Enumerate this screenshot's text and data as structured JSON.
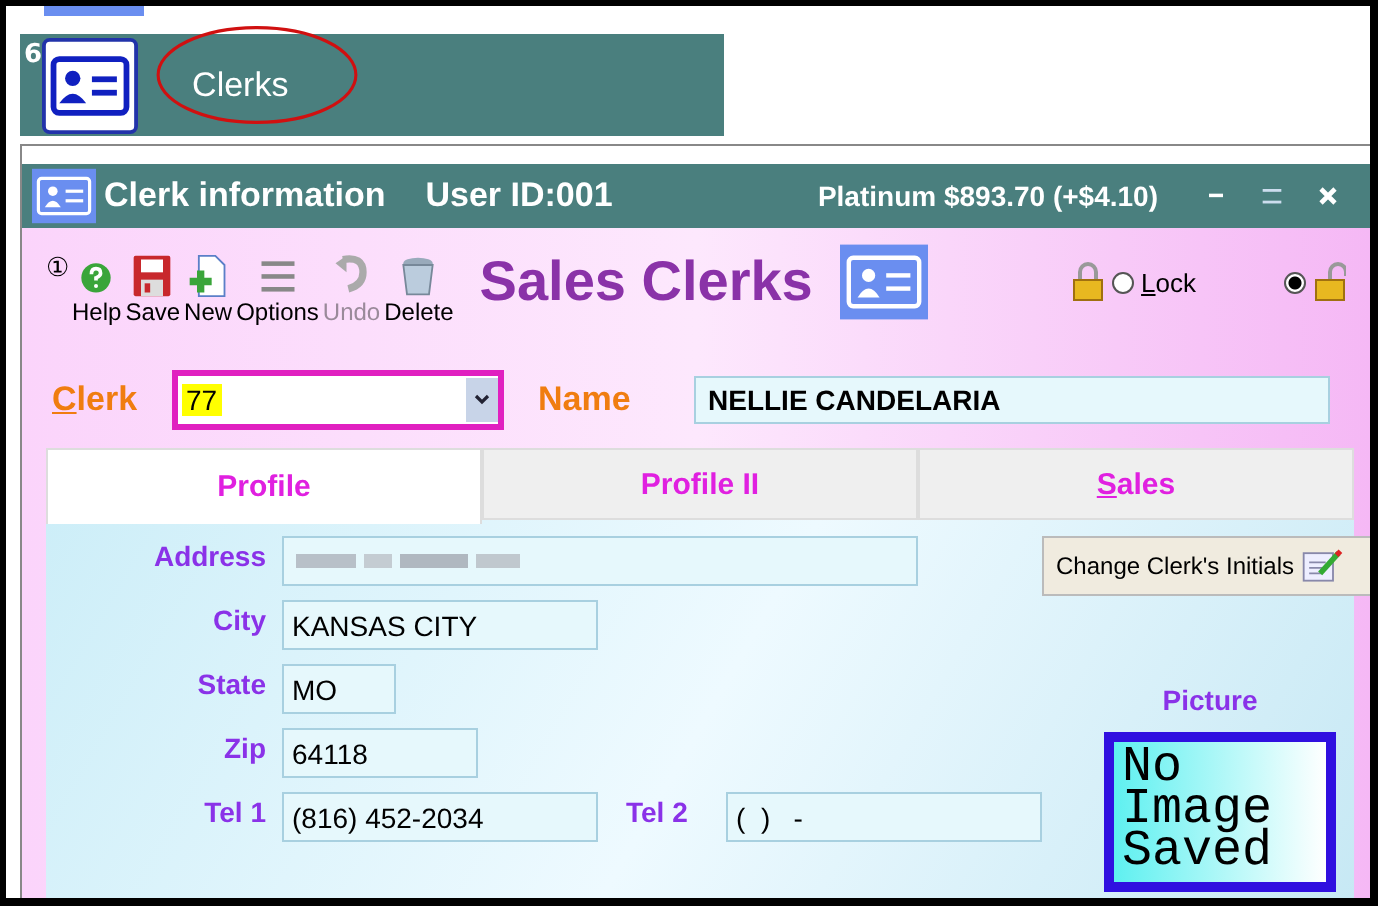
{
  "launcher": {
    "badge": "6",
    "label": "Clerks"
  },
  "window": {
    "title": "Clerk information",
    "user": "User ID:001",
    "account": "Platinum $893.70 (+$4.10)"
  },
  "toolbar": {
    "marker": "①",
    "items": [
      {
        "kind": "help",
        "label": "Help",
        "disabled": false
      },
      {
        "kind": "save",
        "label": "Save",
        "disabled": false
      },
      {
        "kind": "new",
        "label": "New",
        "disabled": false
      },
      {
        "kind": "options",
        "label": "Options",
        "disabled": false
      },
      {
        "kind": "undo",
        "label": "Undo",
        "disabled": true
      },
      {
        "kind": "delete",
        "label": "Delete",
        "disabled": false
      }
    ]
  },
  "heading": "Sales Clerks",
  "lock": [
    {
      "kind": "lock",
      "label": "Lock",
      "selected": false
    },
    {
      "kind": "unlock",
      "selected": true
    }
  ],
  "clerk": {
    "label": "Clerk",
    "value": "77"
  },
  "name": {
    "label": "Name",
    "value": "NELLIE CANDELARIA"
  },
  "tabs": [
    {
      "label": "Profile",
      "selected": true,
      "access_key": false
    },
    {
      "label": "Profile II",
      "selected": false,
      "access_key": false
    },
    {
      "label": "Sales",
      "selected": false,
      "access_key": true
    }
  ],
  "profile": {
    "fields": [
      {
        "label": "Address",
        "kind": "redacted"
      },
      {
        "label": "City",
        "value": "KANSAS CITY"
      },
      {
        "label": "State",
        "value": "MO"
      },
      {
        "label": "Zip",
        "value": "64118"
      },
      {
        "label": "Tel 1",
        "value": "(816) 452-2034",
        "extra": {
          "label": "Tel 2",
          "value": "(  )   -"
        }
      }
    ],
    "change_button": "Change Clerk's Initials",
    "picture_label": "Picture",
    "picture_text": "No Image Saved"
  }
}
